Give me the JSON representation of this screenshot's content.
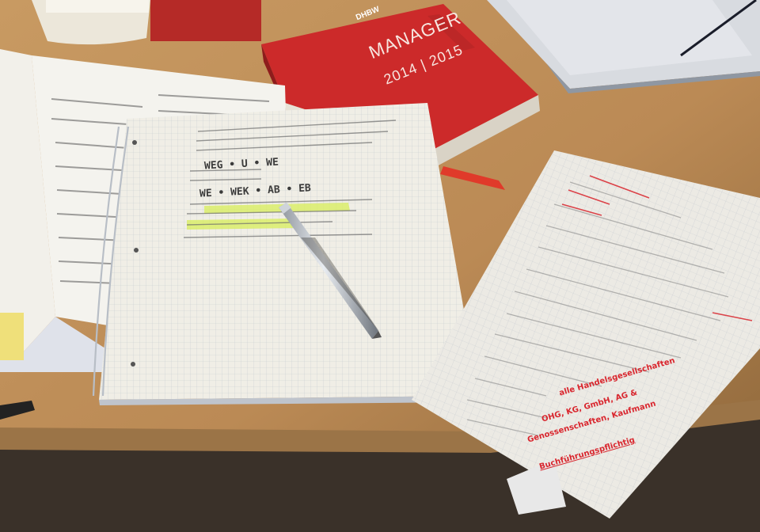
{
  "colors": {
    "desk": "#c8955c",
    "desk_shadow": "#6b4f30",
    "book_red": "#cc2a2a",
    "paper": "#eeeae0",
    "grid": "#c7ccd0",
    "ink": "#3b3b3b",
    "red_ink": "#d9262e"
  },
  "book": {
    "brand": "DHBW",
    "title": "MANAGER",
    "years": "2014 | 2015"
  },
  "notebook": {
    "formula_1": "WEG • U • WE",
    "formula_2": "WE • WEK • AB • EB"
  },
  "loose_sheet": {
    "red_note_1": "alle Handelsgesellschaften",
    "red_note_2": "OHG, KG, GmbH, AG &",
    "red_note_3": "Genossenschaften, Kaufmann",
    "red_note_4": "Buchführungspflichtig"
  }
}
